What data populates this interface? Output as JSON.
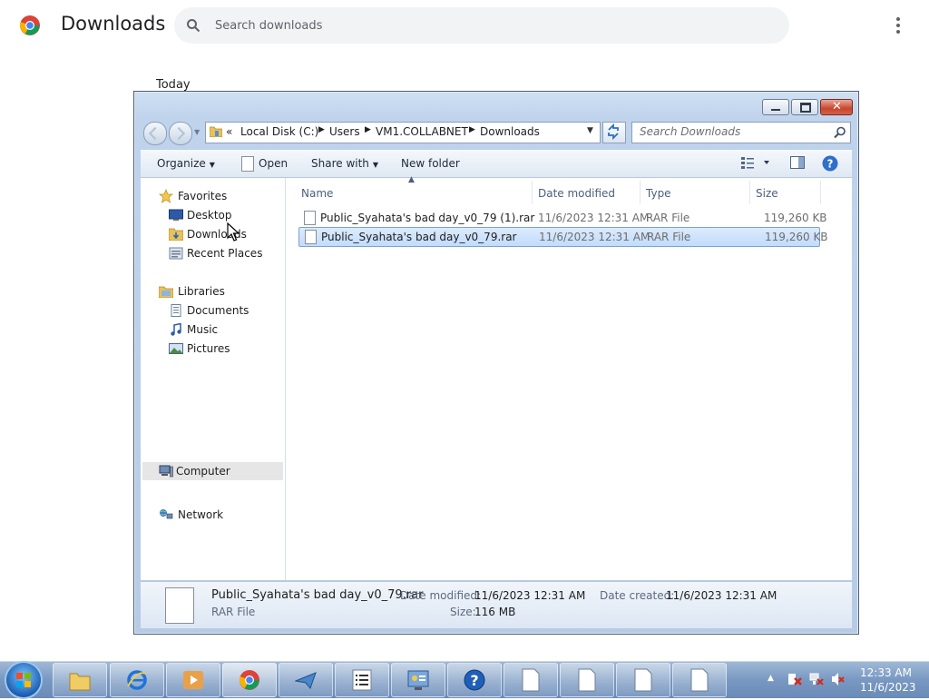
{
  "chrome": {
    "title": "Downloads",
    "search_placeholder": "Search downloads",
    "section_today": "Today"
  },
  "explorer": {
    "address": {
      "overflow": "«",
      "crumbs": [
        "Local Disk (C:)",
        "Users",
        "VM1.COLLABNET",
        "Downloads"
      ]
    },
    "search_placeholder": "Search Downloads",
    "toolbar": {
      "organize": "Organize",
      "open": "Open",
      "share_with": "Share with",
      "new_folder": "New folder"
    },
    "nav": {
      "favorites": "Favorites",
      "desktop": "Desktop",
      "downloads": "Downloads",
      "recent_places": "Recent Places",
      "libraries": "Libraries",
      "documents": "Documents",
      "music": "Music",
      "pictures": "Pictures",
      "computer": "Computer",
      "network": "Network"
    },
    "columns": {
      "name": "Name",
      "date_modified": "Date modified",
      "type": "Type",
      "size": "Size"
    },
    "files": [
      {
        "name": "Public_Syahata's bad day_v0_79 (1).rar",
        "date": "11/6/2023 12:31 AM",
        "type": "RAR File",
        "size": "119,260 KB",
        "selected": false
      },
      {
        "name": "Public_Syahata's bad day_v0_79.rar",
        "date": "11/6/2023 12:31 AM",
        "type": "RAR File",
        "size": "119,260 KB",
        "selected": true
      }
    ],
    "details": {
      "filename": "Public_Syahata's bad day_v0_79.rar",
      "filetype": "RAR File",
      "date_modified_label": "Date modified:",
      "date_modified": "11/6/2023 12:31 AM",
      "size_label": "Size:",
      "size": "116 MB",
      "date_created_label": "Date created:",
      "date_created": "11/6/2023 12:31 AM"
    }
  },
  "taskbar": {
    "clock_time": "12:33 AM",
    "clock_date": "11/6/2023"
  },
  "colors": {
    "selection": "#c1dcfc",
    "taskbar": "#7898c2",
    "chrome_search_bg": "#f1f3f4"
  }
}
